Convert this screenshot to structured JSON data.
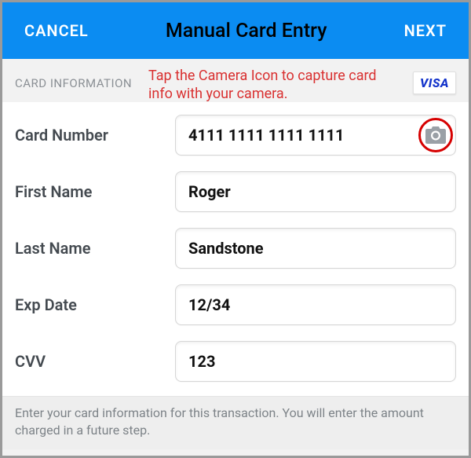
{
  "header": {
    "cancel_label": "CANCEL",
    "title": "Manual Card Entry",
    "next_label": "NEXT"
  },
  "section": {
    "label": "CARD INFORMATION",
    "card_brand": "VISA",
    "hint": "Tap the Camera Icon to capture card info with your camera."
  },
  "fields": {
    "card_number": {
      "label": "Card Number",
      "value": "4111 1111 1111 1111"
    },
    "first_name": {
      "label": "First Name",
      "value": "Roger"
    },
    "last_name": {
      "label": "Last Name",
      "value": "Sandstone"
    },
    "exp_date": {
      "label": "Exp Date",
      "value": "12/34"
    },
    "cvv": {
      "label": "CVV",
      "value": "123"
    }
  },
  "footer": {
    "text": "Enter your card information for this transaction. You will enter the amount charged in a future step."
  }
}
